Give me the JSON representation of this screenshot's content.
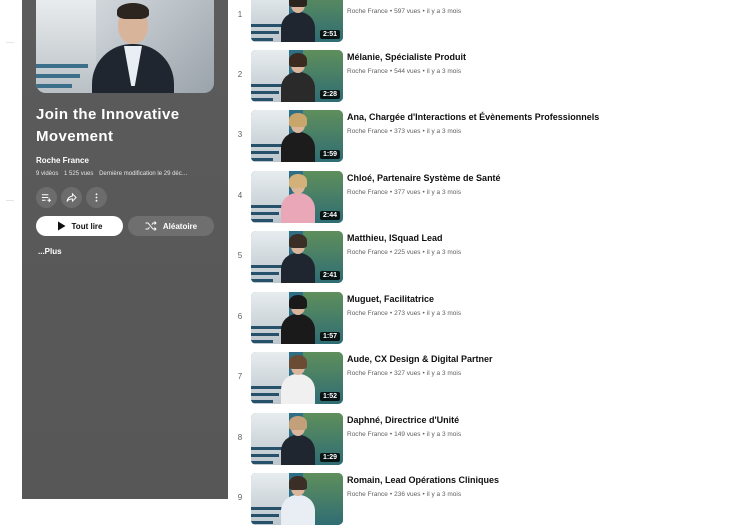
{
  "playlist": {
    "title": "Join the Innovative Movement",
    "channel": "Roche France",
    "video_count": "9 vidéos",
    "views": "1 525 vues",
    "last_modified": "Dernière modification le 29 déc…",
    "play_all_label": "Tout lire",
    "shuffle_label": "Aléatoire",
    "more_label": "...Plus"
  },
  "icons": {
    "save": "add-to-queue-icon",
    "share": "share-icon",
    "more": "more-vert-icon",
    "play": "play-icon",
    "shuffle": "shuffle-icon"
  },
  "colors": {
    "panel": "#595959",
    "thumb_teal": "#2f6f86"
  },
  "videos": [
    {
      "index": "1",
      "title": "",
      "channel": "Roche France",
      "views": "597 vues",
      "age": "il y a 3 mois",
      "duration": "2:51",
      "hair": "#2b241f",
      "body": "#1f2630"
    },
    {
      "index": "2",
      "title": "Mélanie, Spécialiste Produit",
      "channel": "Roche France",
      "views": "544 vues",
      "age": "il y a 3 mois",
      "duration": "2:28",
      "hair": "#3a2a20",
      "body": "#2a2a2a"
    },
    {
      "index": "3",
      "title": "Ana, Chargée d'Interactions et Évènements Professionnels",
      "channel": "Roche France",
      "views": "373 vues",
      "age": "il y a 3 mois",
      "duration": "1:59",
      "hair": "#c8a66b",
      "body": "#1c1c1c"
    },
    {
      "index": "4",
      "title": "Chloé, Partenaire Système de Santé",
      "channel": "Roche France",
      "views": "377 vues",
      "age": "il y a 3 mois",
      "duration": "2:44",
      "hair": "#d2b27a",
      "body": "#e9a7b8"
    },
    {
      "index": "5",
      "title": "Matthieu, ISquad Lead",
      "channel": "Roche France",
      "views": "225 vues",
      "age": "il y a 3 mois",
      "duration": "2:41",
      "hair": "#3a2e26",
      "body": "#1f2630"
    },
    {
      "index": "6",
      "title": "Muguet, Facilitatrice",
      "channel": "Roche France",
      "views": "273 vues",
      "age": "il y a 3 mois",
      "duration": "1:57",
      "hair": "#1a1a1a",
      "body": "#1a1a1a"
    },
    {
      "index": "7",
      "title": "Aude, CX Design & Digital Partner",
      "channel": "Roche France",
      "views": "327 vues",
      "age": "il y a 3 mois",
      "duration": "1:52",
      "hair": "#6a4b34",
      "body": "#f0f0f0"
    },
    {
      "index": "8",
      "title": "Daphné, Directrice d'Unité",
      "channel": "Roche France",
      "views": "149 vues",
      "age": "il y a 3 mois",
      "duration": "1:29",
      "hair": "#c2a07a",
      "body": "#1f2630"
    },
    {
      "index": "9",
      "title": "Romain, Lead Opérations Cliniques",
      "channel": "Roche France",
      "views": "236 vues",
      "age": "il y a 3 mois",
      "duration": "",
      "hair": "#3a2e26",
      "body": "#e8eef3"
    }
  ]
}
